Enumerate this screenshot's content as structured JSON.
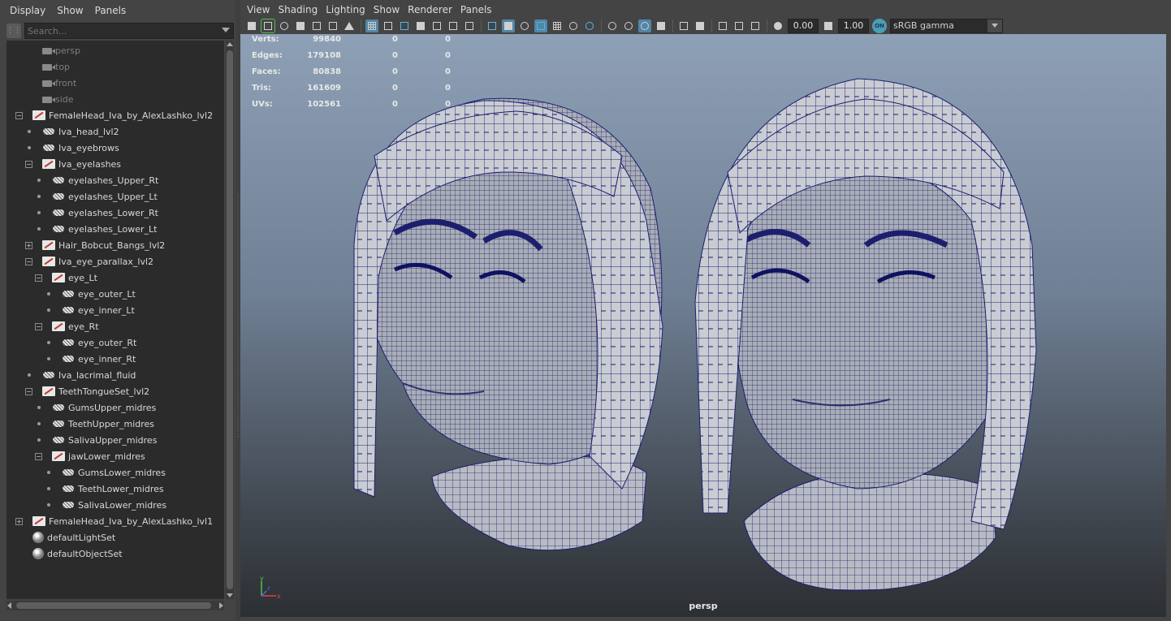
{
  "outliner": {
    "menu": [
      "Display",
      "Show",
      "Panels"
    ],
    "search_placeholder": "Search...",
    "tree": [
      {
        "label": "persp",
        "icon": "camera-icon",
        "indent": 1,
        "dim": true
      },
      {
        "label": "top",
        "icon": "camera-icon",
        "indent": 1,
        "dim": true
      },
      {
        "label": "front",
        "icon": "camera-icon",
        "indent": 1,
        "dim": true
      },
      {
        "label": "side",
        "icon": "camera-icon",
        "indent": 1,
        "dim": true
      },
      {
        "label": "FemaleHead_Iva_by_AlexLashko_lvl2",
        "icon": "group-icon",
        "indent": 0,
        "toggle": "minus"
      },
      {
        "label": "Iva_head_lvl2",
        "icon": "mesh-icon",
        "indent": 1
      },
      {
        "label": "Iva_eyebrows",
        "icon": "mesh-icon",
        "indent": 1
      },
      {
        "label": "Iva_eyelashes",
        "icon": "group-icon",
        "indent": 1,
        "toggle": "minus"
      },
      {
        "label": "eyelashes_Upper_Rt",
        "icon": "mesh-icon",
        "indent": 2
      },
      {
        "label": "eyelashes_Upper_Lt",
        "icon": "mesh-icon",
        "indent": 2
      },
      {
        "label": "eyelashes_Lower_Rt",
        "icon": "mesh-icon",
        "indent": 2
      },
      {
        "label": "eyelashes_Lower_Lt",
        "icon": "mesh-icon",
        "indent": 2
      },
      {
        "label": "Hair_Bobcut_Bangs_lvl2",
        "icon": "group-icon",
        "indent": 1,
        "toggle": "plus"
      },
      {
        "label": "Iva_eye_parallax_lvl2",
        "icon": "group-icon",
        "indent": 1,
        "toggle": "minus"
      },
      {
        "label": "eye_Lt",
        "icon": "group-icon",
        "indent": 2,
        "toggle": "minus"
      },
      {
        "label": "eye_outer_Lt",
        "icon": "mesh-icon",
        "indent": 3
      },
      {
        "label": "eye_inner_Lt",
        "icon": "mesh-icon",
        "indent": 3
      },
      {
        "label": "eye_Rt",
        "icon": "group-icon",
        "indent": 2,
        "toggle": "minus"
      },
      {
        "label": "eye_outer_Rt",
        "icon": "mesh-icon",
        "indent": 3
      },
      {
        "label": "eye_inner_Rt",
        "icon": "mesh-icon",
        "indent": 3
      },
      {
        "label": "Iva_lacrimal_fluid",
        "icon": "mesh-icon",
        "indent": 1
      },
      {
        "label": "TeethTongueSet_lvl2",
        "icon": "group-icon",
        "indent": 1,
        "toggle": "minus"
      },
      {
        "label": "GumsUpper_midres",
        "icon": "mesh-icon",
        "indent": 2
      },
      {
        "label": "TeethUpper_midres",
        "icon": "mesh-icon",
        "indent": 2
      },
      {
        "label": "SalivaUpper_midres",
        "icon": "mesh-icon",
        "indent": 2
      },
      {
        "label": "jawLower_midres",
        "icon": "group-icon",
        "indent": 2,
        "toggle": "minus"
      },
      {
        "label": "GumsLower_midres",
        "icon": "mesh-icon",
        "indent": 3
      },
      {
        "label": "TeethLower_midres",
        "icon": "mesh-icon",
        "indent": 3
      },
      {
        "label": "SalivaLower_midres",
        "icon": "mesh-icon",
        "indent": 3
      },
      {
        "label": "FemaleHead_Iva_by_AlexLashko_lvl1",
        "icon": "group-icon",
        "indent": 0,
        "toggle": "plus"
      },
      {
        "label": "defaultLightSet",
        "icon": "set-icon",
        "indent": 0
      },
      {
        "label": "defaultObjectSet",
        "icon": "set-icon",
        "indent": 0
      }
    ]
  },
  "viewport": {
    "menu": [
      "View",
      "Shading",
      "Lighting",
      "Show",
      "Renderer",
      "Panels"
    ],
    "exposure": "0.00",
    "gamma": "1.00",
    "colorspace": "sRGB gamma",
    "camera": "persp",
    "hud": [
      {
        "label": "Verts:",
        "v1": "99840",
        "v2": "0",
        "v3": "0"
      },
      {
        "label": "Edges:",
        "v1": "179108",
        "v2": "0",
        "v3": "0"
      },
      {
        "label": "Faces:",
        "v1": "80838",
        "v2": "0",
        "v3": "0"
      },
      {
        "label": "Tris:",
        "v1": "161609",
        "v2": "0",
        "v3": "0"
      },
      {
        "label": "UVs:",
        "v1": "102561",
        "v2": "0",
        "v3": "0"
      }
    ],
    "axis": {
      "x": "x",
      "y": "y",
      "z": "z"
    }
  },
  "colors": {
    "wire": "#1b1f6e",
    "mesh": "#b9bcc4",
    "selected_tool": "#5285a6",
    "highlight": "#4cc24c"
  }
}
